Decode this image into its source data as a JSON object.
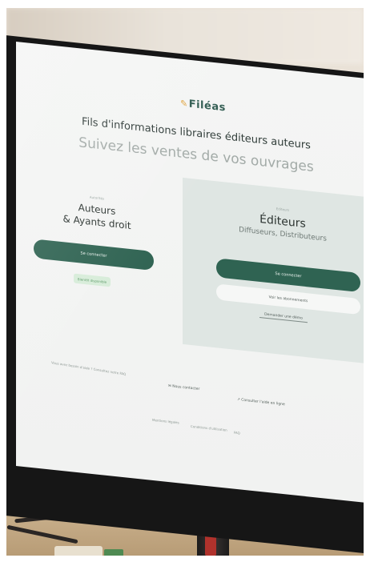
{
  "site": {
    "logo_text": "Filéas",
    "title": "Fils d'informations libraires éditeurs auteurs",
    "subtitle": "Suivez les ventes de vos ouvrages"
  },
  "left_panel": {
    "eyebrow": "Autorités",
    "title_line1": "Auteurs",
    "title_line2": "& Ayants droit",
    "login_button": "Se connecter",
    "badge": "Bientôt disponible"
  },
  "right_panel": {
    "eyebrow": "Editeurs",
    "title": "Éditeurs",
    "subtitle": "Diffuseurs, Distributeurs",
    "login_button": "Se connecter",
    "subscriptions_button": "Voir les abonnements",
    "demo_link": "Demander une démo"
  },
  "footer": {
    "question": "Vous avez besoin d'aide ? Consultez notre FAQ",
    "contact": "Nous contacter",
    "online_order": "Consulter l'aide en ligne",
    "links": [
      "Mentions légales",
      "Conditions d'utilisation",
      "FAQ"
    ]
  },
  "colors": {
    "brand_green": "#2f6352",
    "logo_accent": "#e0a23a",
    "panel_tint": "#dfe6e3",
    "screen_bg": "#f4f5f4"
  }
}
